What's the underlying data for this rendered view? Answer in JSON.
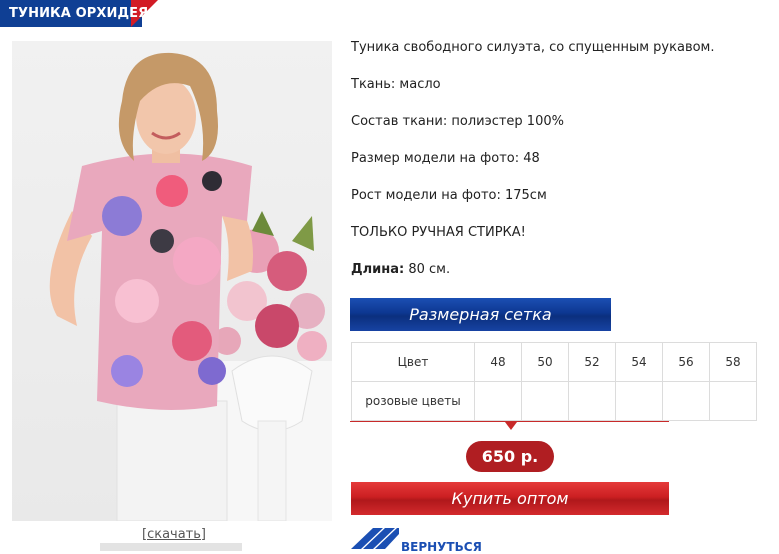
{
  "header": {
    "title": "ТУНИКА ОРХИДЕЯ"
  },
  "gallery": {
    "download_label": "[скачать]"
  },
  "description": {
    "lines": [
      "Туника свободного силуэта, со спущенным рукавом.",
      "Ткань: масло",
      "Состав ткани: полиэстер 100%",
      "Размер модели на фото: 48",
      "Рост модели на фото: 175см",
      "ТОЛЬКО РУЧНАЯ СТИРКА!"
    ],
    "length_label": "Длина:",
    "length_value": "80 см."
  },
  "size_chart": {
    "button_label": "Размерная сетка",
    "header": [
      "Цвет",
      "48",
      "50",
      "52",
      "54",
      "56",
      "58"
    ],
    "rows": [
      [
        "розовые цветы",
        "",
        "",
        "",
        "",
        "",
        ""
      ]
    ]
  },
  "purchase": {
    "price": "650 р.",
    "buy_label": "Купить оптом",
    "back_label": "ВЕРНУТЬСЯ"
  },
  "colors": {
    "brand_blue": "#0f3f94",
    "brand_red": "#c82a2a"
  }
}
